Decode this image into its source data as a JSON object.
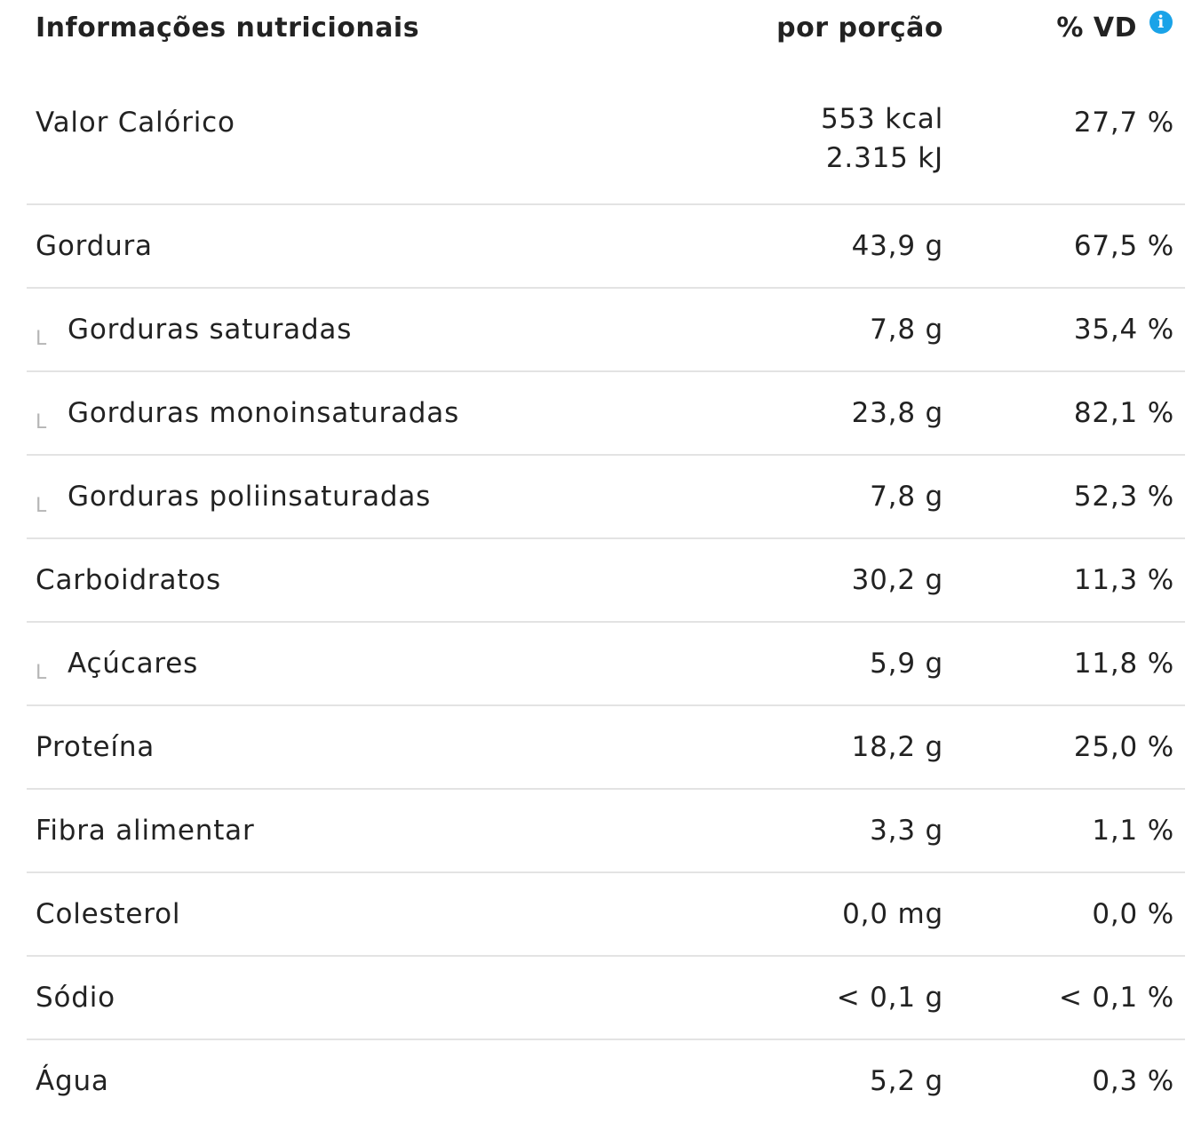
{
  "header": {
    "title": "Informações nutricionais",
    "per_serving": "por porção",
    "daily_value": "% VD",
    "info_icon": "info-icon"
  },
  "calories": {
    "label": "Valor Calórico",
    "kcal": "553 kcal",
    "kj": "2.315 kJ",
    "dv": "27,7 %"
  },
  "rows": [
    {
      "label": "Gordura",
      "amount": "43,9 g",
      "dv": "67,5 %",
      "sub": false
    },
    {
      "label": "Gorduras saturadas",
      "amount": "7,8 g",
      "dv": "35,4 %",
      "sub": true
    },
    {
      "label": "Gorduras monoinsaturadas",
      "amount": "23,8 g",
      "dv": "82,1 %",
      "sub": true
    },
    {
      "label": "Gorduras poliinsaturadas",
      "amount": "7,8 g",
      "dv": "52,3 %",
      "sub": true
    },
    {
      "label": "Carboidratos",
      "amount": "30,2 g",
      "dv": "11,3 %",
      "sub": false
    },
    {
      "label": "Açúcares",
      "amount": "5,9 g",
      "dv": "11,8 %",
      "sub": true
    },
    {
      "label": "Proteína",
      "amount": "18,2 g",
      "dv": "25,0 %",
      "sub": false
    },
    {
      "label": "Fibra alimentar",
      "amount": "3,3 g",
      "dv": "1,1 %",
      "sub": false
    },
    {
      "label": "Colesterol",
      "amount": "0,0 mg",
      "dv": "0,0 %",
      "sub": false
    },
    {
      "label": "Sódio",
      "amount": "< 0,1 g",
      "dv": "< 0,1 %",
      "sub": false
    },
    {
      "label": "Água",
      "amount": "5,2 g",
      "dv": "0,3 %",
      "sub": false
    }
  ],
  "sub_marker": "L",
  "colors": {
    "text": "#222222",
    "divider": "#e3e3e3",
    "sub_marker": "#b5b5b5",
    "info_icon": "#1aa3e8"
  }
}
